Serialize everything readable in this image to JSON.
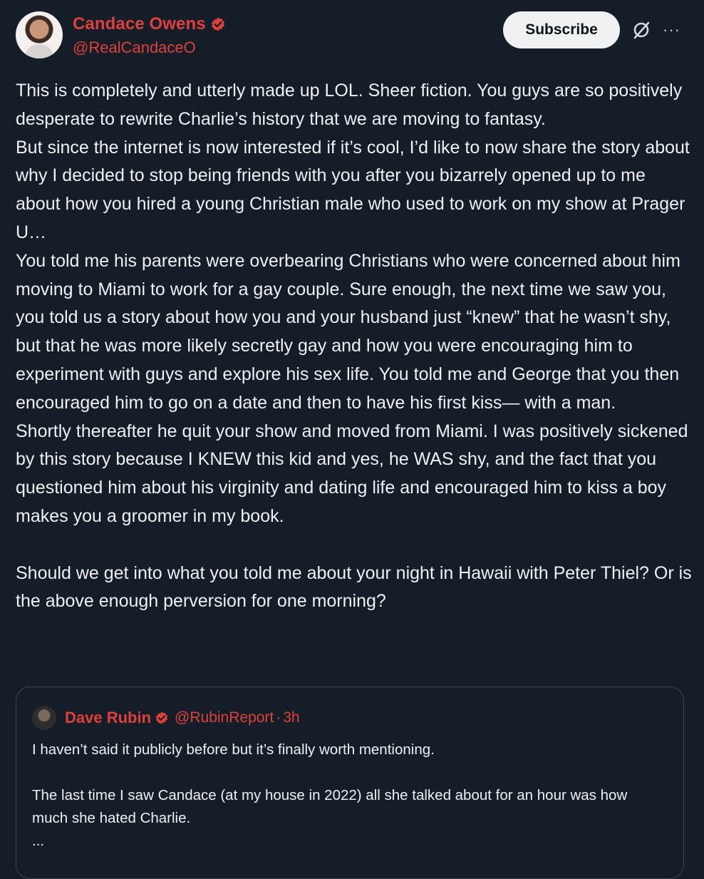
{
  "author": {
    "display_name": "Candace Owens",
    "handle": "@RealCandaceO"
  },
  "header": {
    "subscribe_label": "Subscribe",
    "grok_icon": "slashed-circle-icon",
    "more_icon": "more-horizontal-icon",
    "more_label": "···"
  },
  "post": {
    "lines": [
      "This is completely and utterly made up LOL. Sheer fiction. You guys are so positively desperate to rewrite Charlie’s history that we are moving to fantasy.",
      "But since the internet is now interested if it’s cool, I’d like to now share the story about why I decided to stop being friends with you after you bizarrely opened up to me about how you hired a young Christian male who used to work on my show at Prager U…",
      "You told me his parents were overbearing Christians who were concerned about him moving to Miami to work for a gay couple. Sure enough, the next time we saw you, you told us a story about how you and your husband just “knew” that he wasn’t shy, but that he was more likely secretly gay and how you were encouraging him to experiment with guys and explore his sex life. You told me and George that you then encouraged him to go on a date and then to have his first kiss— with a man.",
      "Shortly thereafter he quit your show and moved from Miami. I was positively sickened by this story because I KNEW this kid and yes, he WAS shy, and the fact that you questioned him about his virginity and dating life and encouraged him to kiss a boy makes you a groomer in my book.",
      "Should we get into what you told me about your night in Hawaii with Peter Thiel? Or is the above enough perversion for one morning?"
    ]
  },
  "quote": {
    "display_name": "Dave Rubin",
    "handle": "@RubinReport",
    "separator": "·",
    "time": "3h",
    "lines": [
      "I haven’t said it publicly before but it’s finally worth mentioning.",
      "The last time I saw Candace (at my house in 2022) all she talked about for an hour was how much she hated Charlie.",
      "..."
    ]
  },
  "colors": {
    "background": "#151d28",
    "accent_red": "#e0403a",
    "text": "#eef0f2",
    "verified_badge": "#e0403a"
  }
}
